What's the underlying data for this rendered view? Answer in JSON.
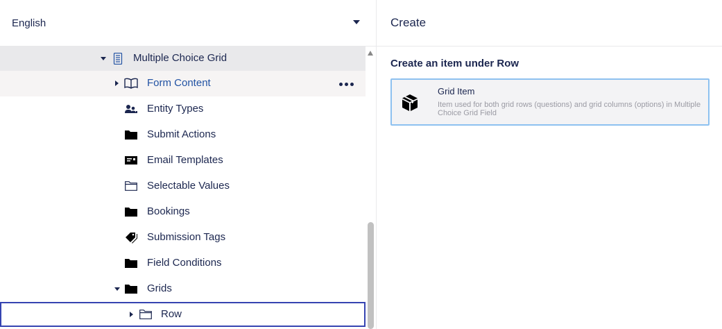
{
  "language": {
    "label": "English"
  },
  "tree": {
    "items": [
      {
        "label": "Multiple Choice Grid",
        "icon": "document-list-icon",
        "expanded": true
      },
      {
        "label": "Form Content",
        "icon": "book-icon",
        "expanded": false
      },
      {
        "label": "Entity Types",
        "icon": "users-icon"
      },
      {
        "label": "Submit Actions",
        "icon": "folder-icon"
      },
      {
        "label": "Email Templates",
        "icon": "email-card-icon"
      },
      {
        "label": "Selectable Values",
        "icon": "folder-outline-icon"
      },
      {
        "label": "Bookings",
        "icon": "folder-icon"
      },
      {
        "label": "Submission Tags",
        "icon": "tags-icon"
      },
      {
        "label": "Field Conditions",
        "icon": "folder-icon"
      },
      {
        "label": "Grids",
        "icon": "folder-icon",
        "expanded": true
      },
      {
        "label": "Row",
        "icon": "folder-outline-icon",
        "expanded": false
      }
    ]
  },
  "create_panel": {
    "title": "Create",
    "subtitle": "Create an item under Row",
    "items": [
      {
        "name": "Grid Item",
        "description": "Item used for both grid rows (questions) and grid columns (options) in Multiple Choice Grid Field",
        "icon": "box-icon"
      }
    ]
  },
  "colors": {
    "text": "#1b264f",
    "link": "#2152a3",
    "selected_row_bg": "#e9e9eb",
    "hover_row_bg": "#f6f4f4",
    "focus_border": "#3544b1",
    "card_border": "#8dc1f0"
  }
}
